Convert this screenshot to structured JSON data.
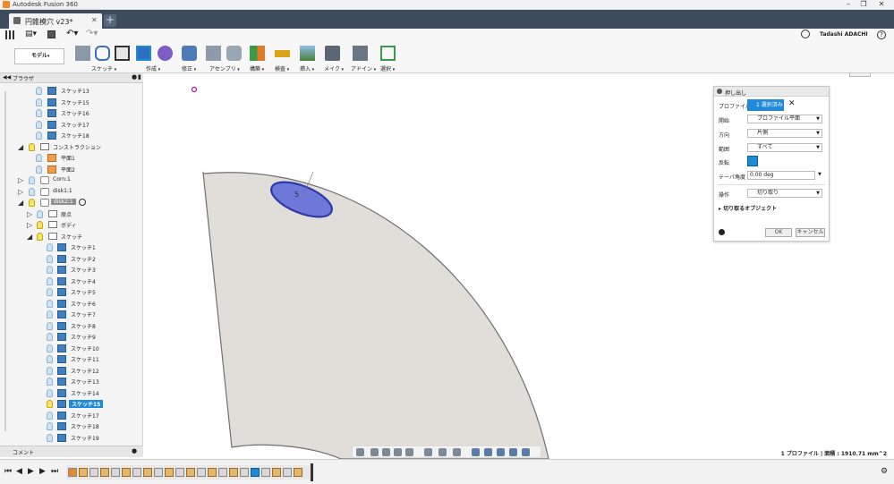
{
  "titlebar": {
    "title": "Autodesk Fusion 360"
  },
  "tabs": [
    {
      "label": "円錐模穴 v23*"
    }
  ],
  "user": {
    "name": "Tadashi ADACHI"
  },
  "workspace": {
    "label": "モデル"
  },
  "toolbar": {
    "groups": [
      {
        "label": "スケッチ"
      },
      {
        "label": "作成"
      },
      {
        "label": "修正"
      },
      {
        "label": "アセンブリ"
      },
      {
        "label": "構築"
      },
      {
        "label": "検査"
      },
      {
        "label": "挿入"
      },
      {
        "label": "メイク"
      },
      {
        "label": "アドイン"
      },
      {
        "label": "選択"
      }
    ]
  },
  "browser": {
    "title": "ブラウザ",
    "items": [
      {
        "label": "スケッチ13"
      },
      {
        "label": "スケッチ15"
      },
      {
        "label": "スケッチ16"
      },
      {
        "label": "スケッチ17"
      },
      {
        "label": "スケッチ18"
      },
      {
        "label": "コンストラクション"
      },
      {
        "label": "平面1"
      },
      {
        "label": "平面2"
      },
      {
        "label": "Corn:1"
      },
      {
        "label": "disk1:1"
      },
      {
        "label": "disk2:1"
      },
      {
        "label": "原点"
      },
      {
        "label": "ボディ"
      },
      {
        "label": "スケッチ"
      },
      {
        "label": "スケッチ1"
      },
      {
        "label": "スケッチ2"
      },
      {
        "label": "スケッチ3"
      },
      {
        "label": "スケッチ4"
      },
      {
        "label": "スケッチ5"
      },
      {
        "label": "スケッチ6"
      },
      {
        "label": "スケッチ7"
      },
      {
        "label": "スケッチ8"
      },
      {
        "label": "スケッチ9"
      },
      {
        "label": "スケッチ10"
      },
      {
        "label": "スケッチ11"
      },
      {
        "label": "スケッチ12"
      },
      {
        "label": "スケッチ13"
      },
      {
        "label": "スケッチ14"
      },
      {
        "label": "スケッチ15"
      },
      {
        "label": "スケッチ17"
      },
      {
        "label": "スケッチ18"
      },
      {
        "label": "スケッチ19"
      }
    ],
    "comment_label": "コメント"
  },
  "viewcube": {
    "face": "前",
    "axis": "Z"
  },
  "canvas": {
    "dimension_text": "5"
  },
  "extrude_panel": {
    "title": "押し出し",
    "rows": [
      {
        "label": "プロファイル",
        "value": "1 選択済み"
      },
      {
        "label": "開始",
        "value": "プロファイル平面"
      },
      {
        "label": "方向",
        "value": "片側"
      },
      {
        "label": "範囲",
        "value": "すべて"
      },
      {
        "label": "反転",
        "value": ""
      },
      {
        "label": "テーパ角度",
        "value": "0.00 deg"
      },
      {
        "label": "操作",
        "value": "切り取り"
      }
    ],
    "objects_label": "切り取るオブジェクト",
    "ok_label": "OK",
    "cancel_label": "キャンセル"
  },
  "status": {
    "text": "1 プロファイル | 面積 : 1910.71 mm^2"
  },
  "colors": {
    "accent": "#1f8ad8",
    "tabbar": "#3d4b5c",
    "body": "#e1ddd8",
    "profile": "#6e78d8"
  }
}
